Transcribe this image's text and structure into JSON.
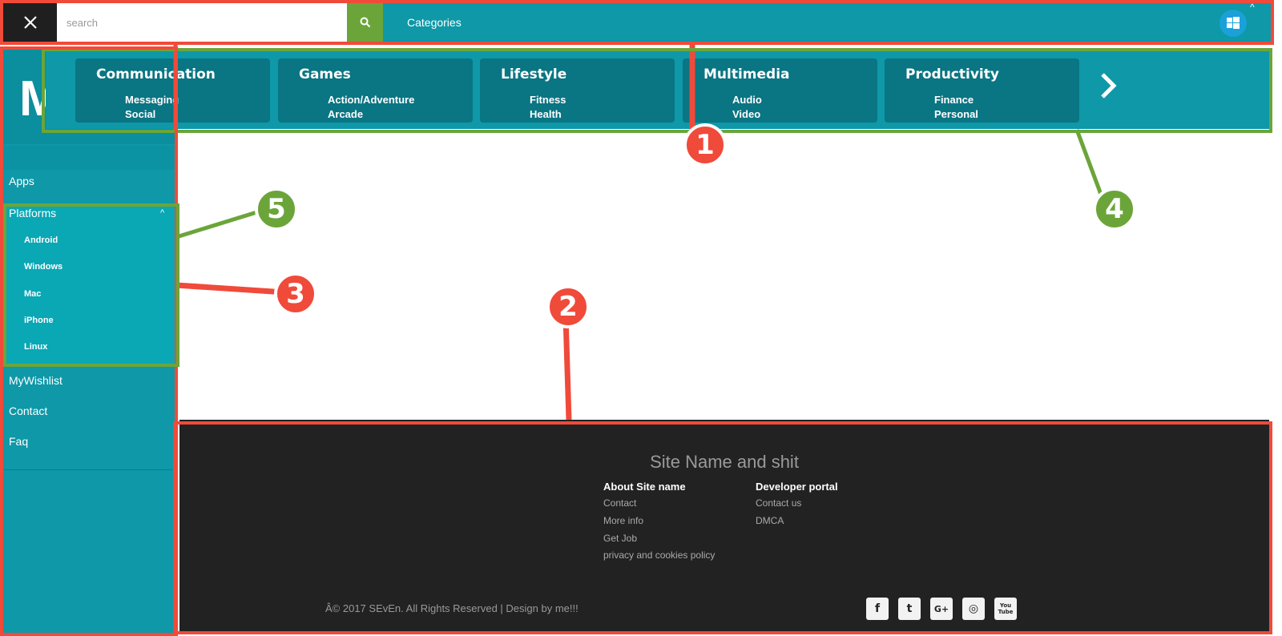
{
  "topbar": {
    "search_placeholder": "search",
    "categories_label": "Categories",
    "collapse_caret": "^"
  },
  "sidebar": {
    "logo_text": "M",
    "items": [
      {
        "label": "Apps"
      },
      {
        "label": "Platforms"
      },
      {
        "label": "MyWishlist"
      },
      {
        "label": "Contact"
      },
      {
        "label": "Faq"
      }
    ],
    "platforms_caret": "^",
    "platform_items": [
      "Android",
      "Windows",
      "Mac",
      "iPhone",
      "Linux"
    ]
  },
  "categories": [
    {
      "title": "Communication",
      "subs": [
        "Messaging",
        "Social"
      ]
    },
    {
      "title": "Games",
      "subs": [
        "Action/Adventure",
        "Arcade"
      ]
    },
    {
      "title": "Lifestyle",
      "subs": [
        "Fitness",
        "Health"
      ]
    },
    {
      "title": "Multimedia",
      "subs": [
        "Audio",
        "Video"
      ]
    },
    {
      "title": "Productivity",
      "subs": [
        "Finance",
        "Personal"
      ]
    }
  ],
  "footer": {
    "title": "Site Name and shit",
    "col1": {
      "heading": "About Site name",
      "links": [
        "Contact",
        "More info",
        "Get Job",
        "privacy and cookies policy"
      ]
    },
    "col2": {
      "heading": "Developer portal",
      "links": [
        "Contact us",
        "DMCA"
      ]
    },
    "copyright": "Â© 2017 SEvEn. All Rights Reserved | Design by me!!!",
    "social": [
      {
        "icon": "facebook-icon",
        "glyph": "f"
      },
      {
        "icon": "twitter-icon",
        "glyph": "t"
      },
      {
        "icon": "google-plus-icon",
        "glyph": "G+"
      },
      {
        "icon": "instagram-icon",
        "glyph": "◎"
      },
      {
        "icon": "youtube-icon",
        "glyph": "You Tube"
      }
    ]
  },
  "annotations": [
    "1",
    "2",
    "3",
    "4",
    "5"
  ],
  "colors": {
    "teal": "#0e98a8",
    "dark": "#222222",
    "red": "#f04a3a",
    "green": "#6ba53a"
  }
}
